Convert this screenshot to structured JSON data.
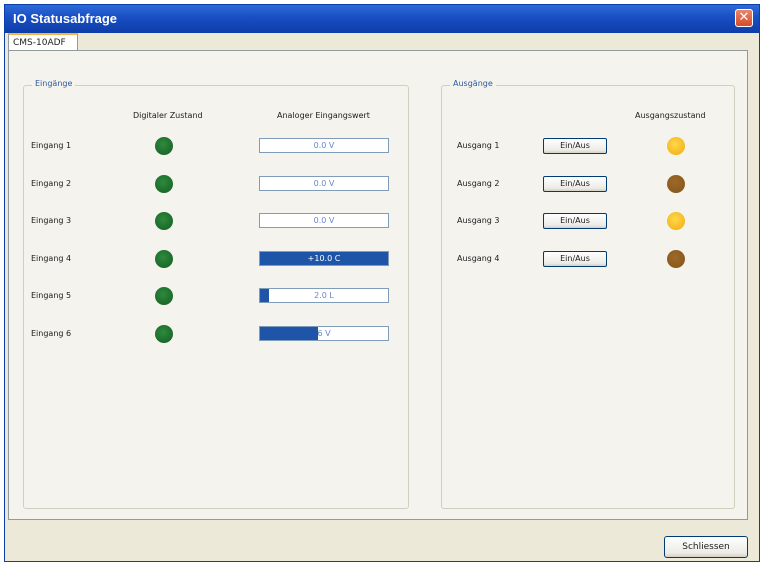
{
  "window": {
    "title": "IO Statusabfrage",
    "close_glyph": "✕"
  },
  "tab": {
    "label": "CMS-10ADF"
  },
  "inputs": {
    "group_title": "Eingänge",
    "col_digital": "Digitaler Zustand",
    "col_analog": "Analoger Eingangswert",
    "rows": [
      {
        "label": "Eingang 1",
        "digital_color": "#1b6a2a",
        "analog_text": "0.0 V",
        "fill_fraction": 0.0
      },
      {
        "label": "Eingang 2",
        "digital_color": "#1b6a2a",
        "analog_text": "0.0 V",
        "fill_fraction": 0.0
      },
      {
        "label": "Eingang 3",
        "digital_color": "#1b6a2a",
        "analog_text": "0.0 V",
        "fill_fraction": 0.0
      },
      {
        "label": "Eingang 4",
        "digital_color": "#1b6a2a",
        "analog_text": "+10.0 C",
        "fill_fraction": 1.0
      },
      {
        "label": "Eingang 5",
        "digital_color": "#1b6a2a",
        "analog_text": "2.0 L",
        "fill_fraction": 0.07
      },
      {
        "label": "Eingang 6",
        "digital_color": "#1b6a2a",
        "analog_text": "6 V",
        "fill_fraction": 0.45
      }
    ]
  },
  "outputs": {
    "group_title": "Ausgänge",
    "col_state": "Ausgangszustand",
    "rows": [
      {
        "label": "Ausgang 1",
        "button_label": "Ein/Aus",
        "state": "on"
      },
      {
        "label": "Ausgang 2",
        "button_label": "Ein/Aus",
        "state": "off"
      },
      {
        "label": "Ausgang 3",
        "button_label": "Ein/Aus",
        "state": "on"
      },
      {
        "label": "Ausgang 4",
        "button_label": "Ein/Aus",
        "state": "off"
      }
    ]
  },
  "footer": {
    "close_button_label": "Schliessen"
  },
  "colors": {
    "titlebar": "#1a51c5",
    "led_green": "#1b6a2a",
    "led_on": "#f5b820",
    "led_off": "#8a5a1e",
    "bar_fill": "#1e55a8"
  }
}
